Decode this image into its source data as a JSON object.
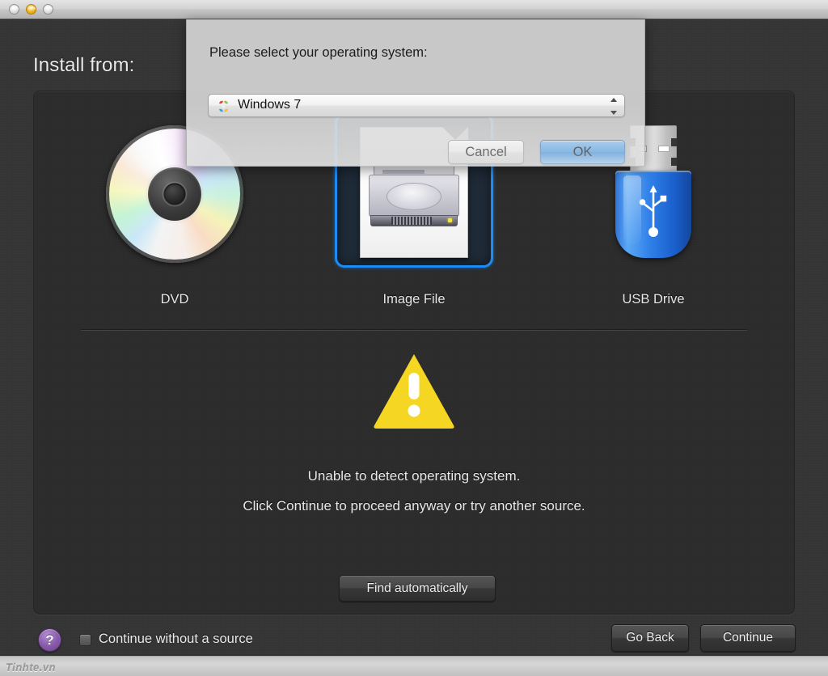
{
  "window": {
    "titlebar": {
      "close_label": "close",
      "minimize_label": "minimize",
      "zoom_label": "zoom"
    },
    "watermark": "Tinhte.vn"
  },
  "page": {
    "heading": "Install from:"
  },
  "sources": {
    "items": [
      {
        "id": "dvd",
        "label": "DVD",
        "icon": "dvd-disc-icon",
        "selected": false
      },
      {
        "id": "image",
        "label": "Image File",
        "icon": "disk-image-file-icon",
        "selected": true
      },
      {
        "id": "usb",
        "label": "USB Drive",
        "icon": "usb-drive-icon",
        "selected": false
      }
    ],
    "selection_color": "#1b8cf5"
  },
  "status": {
    "icon": "warning-triangle-icon",
    "warning_color": "#f5d623",
    "line1": "Unable to detect operating system.",
    "line2": "Click Continue to proceed anyway or try another source."
  },
  "actions": {
    "find_automatically_label": "Find automatically"
  },
  "footer": {
    "help_label": "?",
    "help_icon": "question-mark-icon",
    "help_color": "#8b5fae",
    "checkbox_label": "Continue without a source",
    "checkbox_checked": false,
    "go_back_label": "Go Back",
    "continue_label": "Continue"
  },
  "sheet": {
    "prompt": "Please select your operating system:",
    "os_popup": {
      "icon": "windows-logo-icon",
      "value": "Windows 7",
      "options": [
        "Windows 7"
      ]
    },
    "cancel_label": "Cancel",
    "ok_label": "OK",
    "default_button": "OK"
  }
}
